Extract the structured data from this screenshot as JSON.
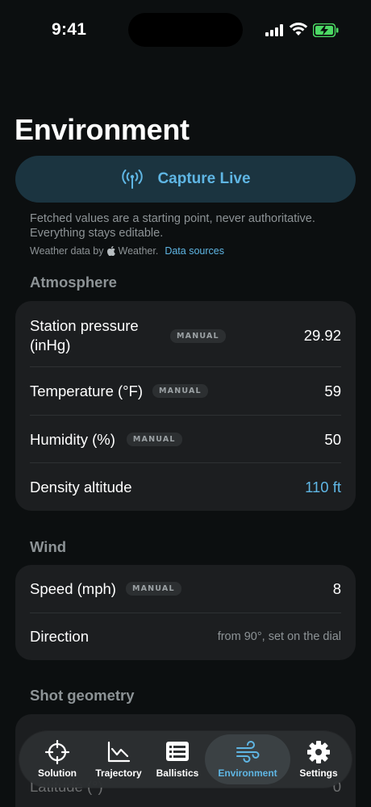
{
  "status_bar": {
    "time": "9:41"
  },
  "page": {
    "title": "Environment"
  },
  "capture": {
    "label": "Capture Live"
  },
  "info": {
    "text": "Fetched values are a starting point, never authoritative. Everything stays editable.",
    "weather_prefix": "Weather data by",
    "weather_brand": "Weather.",
    "data_sources_link": "Data sources"
  },
  "atmosphere": {
    "header": "Atmosphere",
    "rows": [
      {
        "label": "Station pressure (inHg)",
        "badge": "MANUAL",
        "value": "29.92"
      },
      {
        "label": "Temperature (°F)",
        "badge": "MANUAL",
        "value": "59"
      },
      {
        "label": "Humidity (%)",
        "badge": "MANUAL",
        "value": "50"
      },
      {
        "label": "Density altitude",
        "value": "110 ft"
      }
    ]
  },
  "wind": {
    "header": "Wind",
    "rows": [
      {
        "label": "Speed (mph)",
        "badge": "MANUAL",
        "value": "8"
      },
      {
        "label": "Direction",
        "value": "from 90°, set on the dial"
      }
    ]
  },
  "shot_geometry": {
    "header": "Shot geometry",
    "rows": [
      {
        "label": "Latitude (°)",
        "value": "0"
      }
    ]
  },
  "tabs": [
    {
      "label": "Solution",
      "icon": "crosshair-icon"
    },
    {
      "label": "Trajectory",
      "icon": "trajectory-chart-icon"
    },
    {
      "label": "Ballistics",
      "icon": "list-icon"
    },
    {
      "label": "Environment",
      "icon": "wind-icon",
      "active": true
    },
    {
      "label": "Settings",
      "icon": "gear-icon"
    }
  ],
  "colors": {
    "accent": "#5fb6e4",
    "background": "#0c0f10",
    "card": "#1c1e20",
    "battery": "#4cd964"
  }
}
